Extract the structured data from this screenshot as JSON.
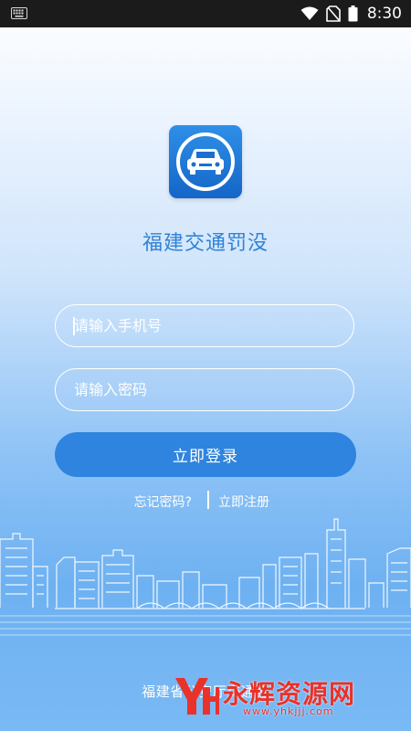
{
  "status_bar": {
    "time": "8:30",
    "icons": [
      "keyboard-icon",
      "wifi-icon",
      "no-sim-icon",
      "battery-icon"
    ]
  },
  "app": {
    "logo_icon": "car-icon",
    "title": "福建交通罚没"
  },
  "login_form": {
    "phone_placeholder": "请输入手机号",
    "password_placeholder": "请输入密码",
    "submit_label": "立即登录"
  },
  "links": {
    "forgot_password": "忘记密码?",
    "register": "立即注册"
  },
  "footer": {
    "text": "福建省公安厅交通警"
  },
  "watermark": {
    "name": "永辉资源网",
    "url": "www.yhkjjj.com"
  },
  "colors": {
    "accent": "#2e84de",
    "title": "#2f82d6",
    "watermark": "#e8322a"
  }
}
